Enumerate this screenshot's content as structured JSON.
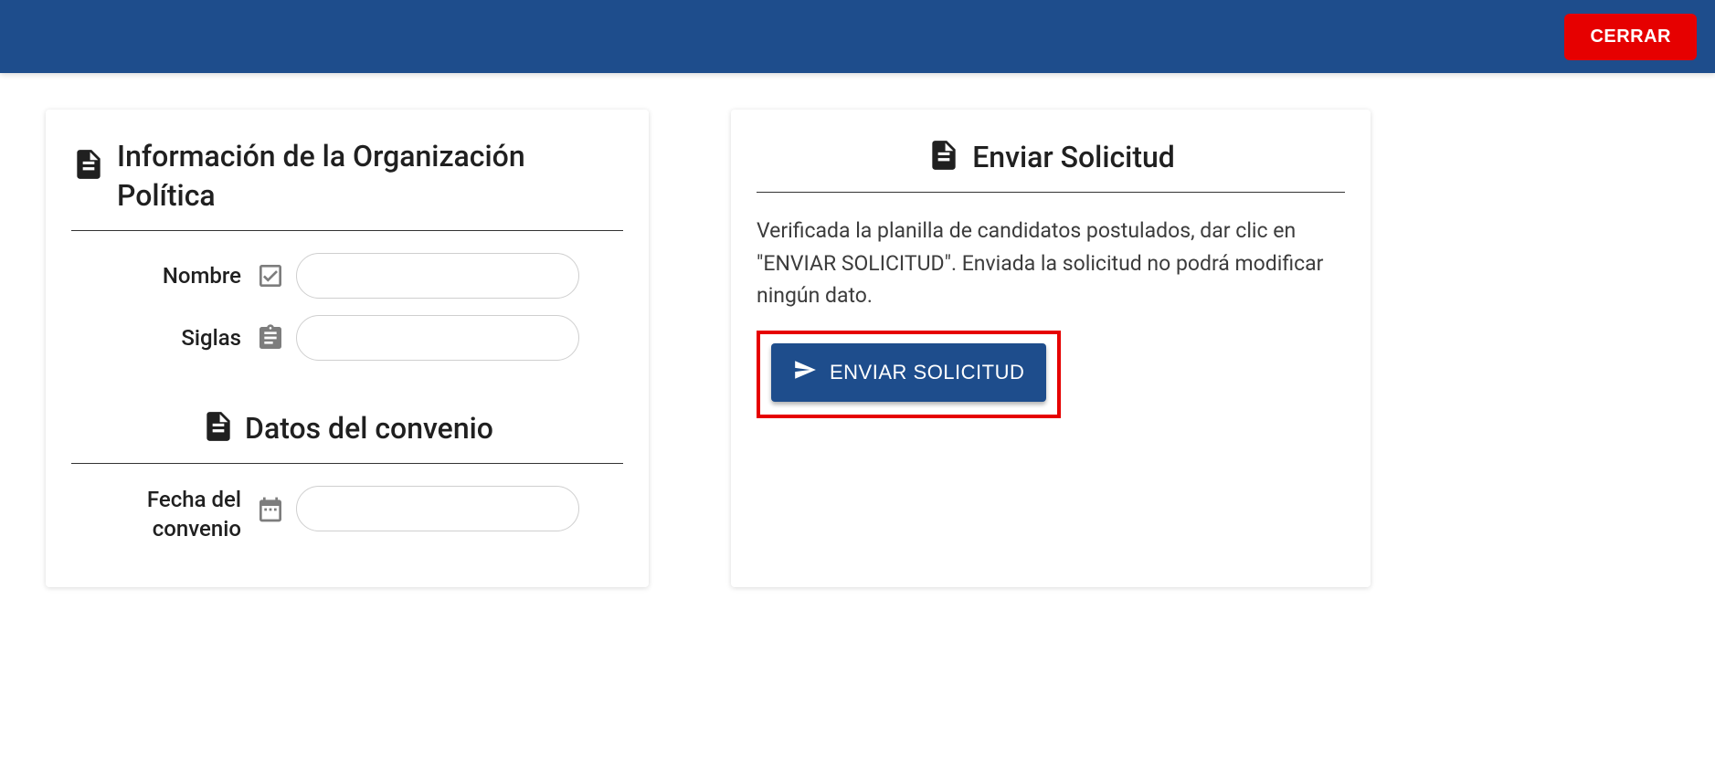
{
  "topbar": {
    "close_label": "CERRAR"
  },
  "left_card": {
    "title": "Información de la Organización Política",
    "fields": {
      "nombre": {
        "label": "Nombre",
        "value": ""
      },
      "siglas": {
        "label": "Siglas",
        "value": ""
      }
    },
    "section2": {
      "title": "Datos del convenio",
      "fields": {
        "fecha": {
          "label": "Fecha del convenio",
          "value": ""
        }
      }
    }
  },
  "right_card": {
    "title": "Enviar Solicitud",
    "instruction": "Verificada la planilla de candidatos postulados, dar clic en \"ENVIAR SOLICITUD\". Enviada la solicitud no podrá modificar ningún dato.",
    "submit_label": "ENVIAR SOLICITUD"
  }
}
